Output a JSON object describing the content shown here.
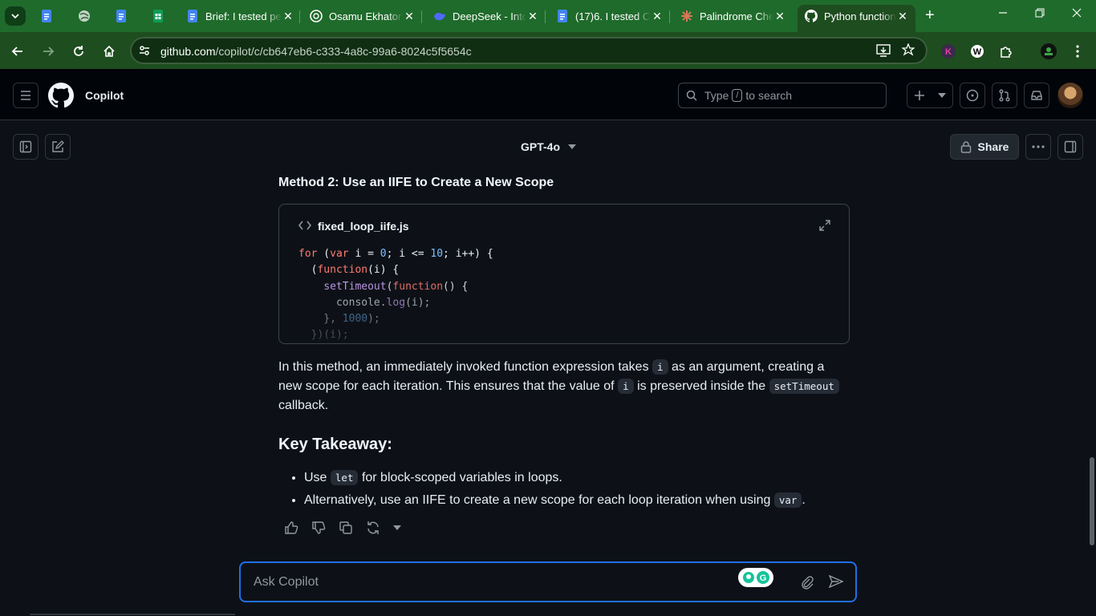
{
  "browser": {
    "tabs": [
      {
        "title": "",
        "icon": "google-docs-icon",
        "color": "#4285f4"
      },
      {
        "title": "",
        "icon": "globe-icon",
        "color": "#cfd8cf"
      },
      {
        "title": "",
        "icon": "google-docs-icon",
        "color": "#4285f4"
      },
      {
        "title": "",
        "icon": "google-sheets-icon",
        "color": "#0f9d58"
      },
      {
        "title": "Brief: I tested pe",
        "icon": "google-docs-icon",
        "color": "#4285f4"
      },
      {
        "title": "Osamu Ekhator",
        "icon": "openai-icon",
        "color": "#ffffff"
      },
      {
        "title": "DeepSeek - Into",
        "icon": "deepseek-icon",
        "color": "#4d6bfe"
      },
      {
        "title": "(17)6. I tested C",
        "icon": "google-docs-icon",
        "color": "#4285f4"
      },
      {
        "title": "Palindrome Che",
        "icon": "claude-icon",
        "color": "#d97757"
      },
      {
        "title": "Python function",
        "icon": "github-icon",
        "color": "#ffffff",
        "active": true
      }
    ],
    "url_host": "github.com",
    "url_path": "/copilot/c/cb647eb6-c333-4a8c-99a6-8024c5f5654c"
  },
  "header": {
    "title": "Copilot",
    "search_prefix": "Type",
    "search_key": "/",
    "search_suffix": "to search"
  },
  "subbar": {
    "model": "GPT-4o",
    "share": "Share"
  },
  "message": {
    "heading": "Method 2: Use an IIFE to Create a New Scope",
    "code_filename": "fixed_loop_iife.js",
    "para_1": "In this method, an immediately invoked function expression takes",
    "para_code_1": "i",
    "para_2": "as an argument, creating a new scope for each iteration. This ensures that the value of",
    "para_code_2": "i",
    "para_3": "is preserved inside the",
    "para_code_3": "setTimeout",
    "para_4": "callback.",
    "takeaway_heading": "Key Takeaway:",
    "bullet_1_pre": "Use",
    "bullet_1_code": "let",
    "bullet_1_post": "for block-scoped variables in loops.",
    "bullet_2_pre": "Alternatively, use an IIFE to create a new scope for each loop iteration when using",
    "bullet_2_code": "var",
    "bullet_2_post": "."
  },
  "composer": {
    "placeholder": "Ask Copilot"
  },
  "colors": {
    "accent": "#1f6feb",
    "browser_frame": "#1e4d1f"
  }
}
